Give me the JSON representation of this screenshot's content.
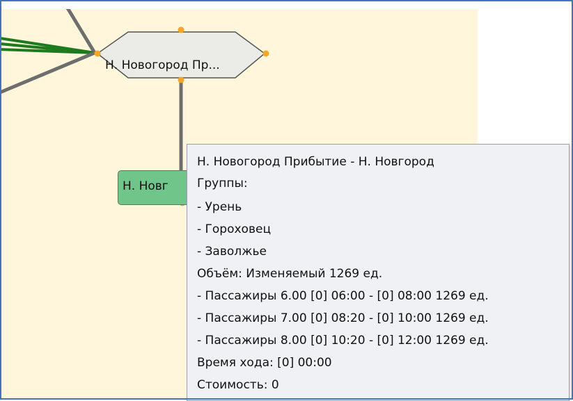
{
  "graph": {
    "station_node_label": "Н. Новогород Пр...",
    "green_node_label": "Н. Новг"
  },
  "tooltip": {
    "title": "Н. Новогород Прибытие - Н. Новгород",
    "groups_heading": "Группы:",
    "groups": [
      "- Урень",
      "- Гороховец",
      "- Заволжье"
    ],
    "volume": "Объём: Изменяемый 1269 ед.",
    "trips": [
      "- Пассажиры 6.00 [0] 06:00 - [0] 08:00 1269 ед.",
      "- Пассажиры 7.00 [0] 08:20 - [0] 10:00 1269 ед.",
      "- Пассажиры 8.00 [0] 10:20 - [0] 12:00 1269 ед."
    ],
    "travel_time": "Время хода: [0] 00:00",
    "cost": "Стоимость: 0"
  },
  "colors": {
    "canvas_bg": "#fff6dc",
    "frame": "#4472c4",
    "port": "#f5a623",
    "green_node": "#6fc58a",
    "edge_gray": "#6e6e6e",
    "edge_green": "#1e7a1e"
  }
}
